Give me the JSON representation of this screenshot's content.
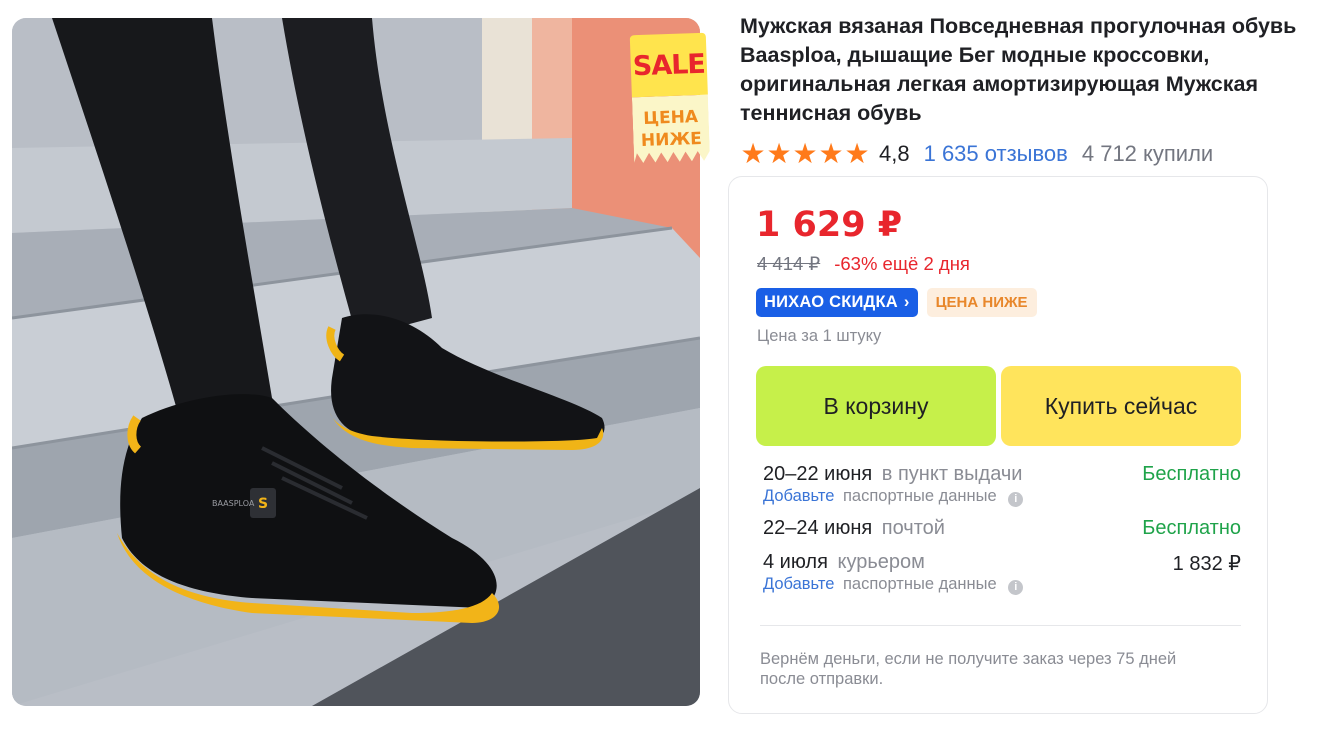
{
  "image": {
    "alt_icon": "sneakers-photo",
    "sticker": {
      "top": "SALE",
      "bottom_line1": "ЦЕНА",
      "bottom_line2": "НИЖЕ"
    },
    "shoe_logo_text": "BAASPLOA"
  },
  "product": {
    "title": "Мужская вязаная Повседневная прогулочная обувь Baasploa, дышащие Бег модные кроссовки, оригинальная легкая амортизирующая Мужская теннисная обувь",
    "rating": "4,8",
    "stars_count": 5,
    "reviews": "1 635 отзывов",
    "purchases": "4 712 купили"
  },
  "pricing": {
    "price": "1 629 ₽",
    "old_price": "4 414 ₽",
    "discount": "-63% ещё 2 дня",
    "badge_sale": "НИХАО СКИДКА",
    "badge_lower": "ЦЕНА НИЖЕ",
    "unit_note": "Цена за 1 штуку"
  },
  "actions": {
    "cart": "В корзину",
    "buy_now": "Купить сейчас"
  },
  "delivery": {
    "options": [
      {
        "date": "20–22 июня",
        "method": "в пункт выдачи",
        "cost": "Бесплатно",
        "note_link": "Добавьте",
        "note_text": "паспортные данные"
      },
      {
        "date": "22–24 июня",
        "method": "почтой",
        "cost": "Бесплатно"
      },
      {
        "date": "4 июля",
        "method": "курьером",
        "cost": "1 832 ₽",
        "note_link": "Добавьте",
        "note_text": "паспортные данные"
      }
    ],
    "refund_note": "Вернём деньги, если не получите заказ через 75 дней после отправки."
  },
  "colors": {
    "price_red": "#e8262d",
    "link_blue": "#3a74d6",
    "free_green": "#1fa34a",
    "cart_green": "#c6f04a",
    "buy_yellow": "#ffe45c",
    "star_orange": "#ff7a1a",
    "sale_badge_blue": "#1a5fe6"
  }
}
